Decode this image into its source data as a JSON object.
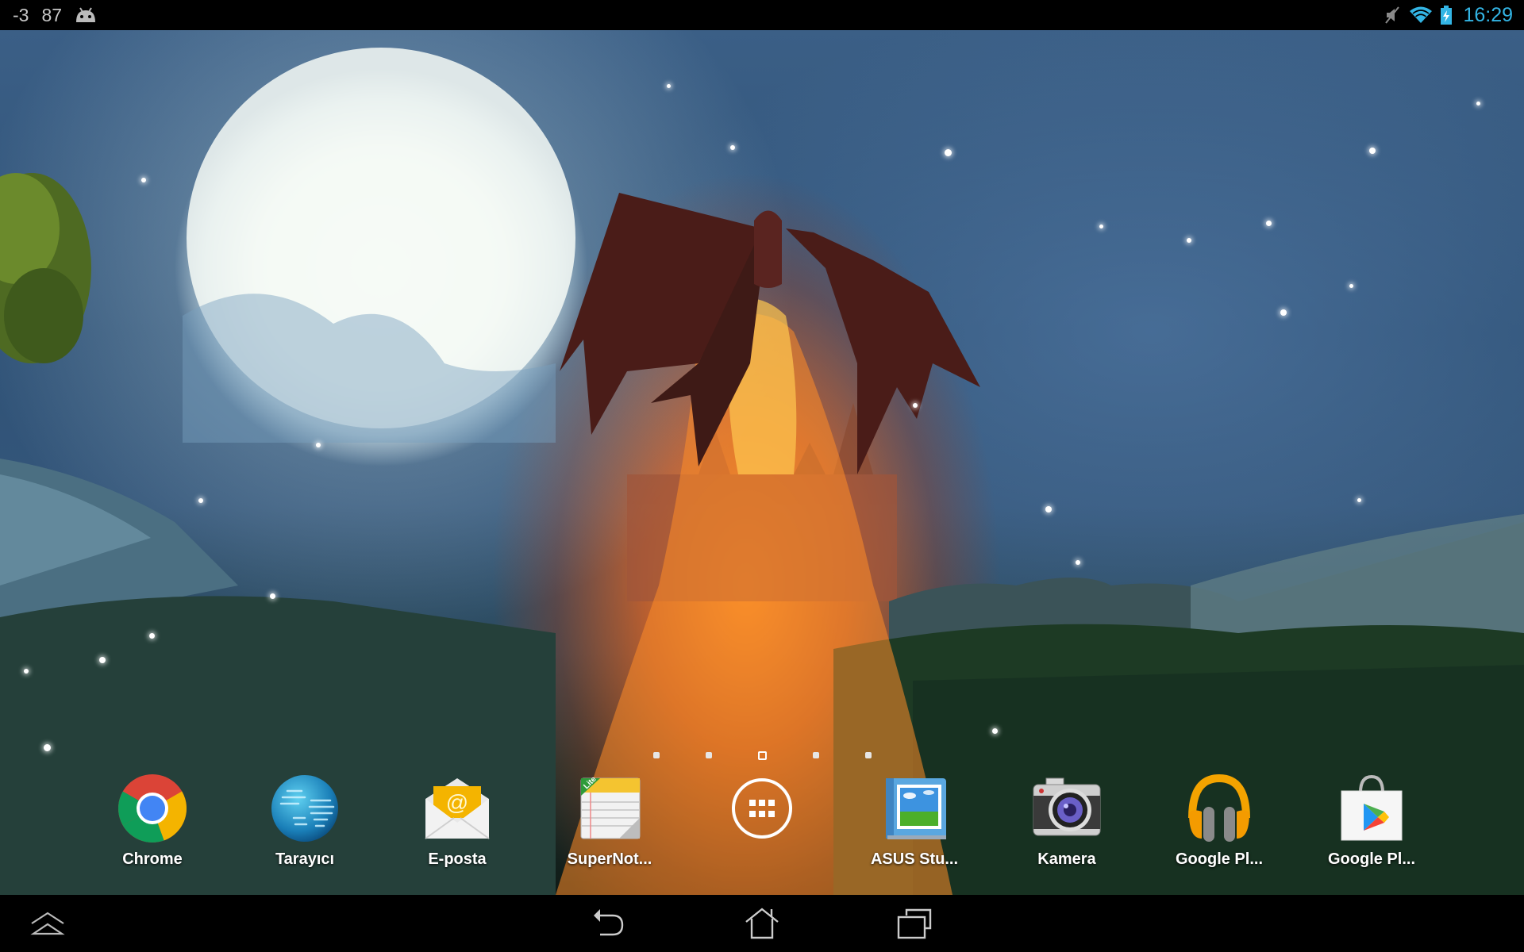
{
  "status_bar": {
    "left_indicators": [
      {
        "name": "notification-count-a",
        "text": "-3"
      },
      {
        "name": "notification-count-b",
        "text": "87"
      }
    ],
    "left_icons": [
      "android-debug-icon"
    ],
    "right_icons": [
      "mute-icon",
      "wifi-icon",
      "battery-charging-icon"
    ],
    "time": "16:29",
    "accent_color": "#33b5e5"
  },
  "home_screen": {
    "pages_total": 5,
    "current_page": 3
  },
  "dock": {
    "items": [
      {
        "name": "chrome",
        "label": "Chrome",
        "icon": "chrome-icon"
      },
      {
        "name": "browser",
        "label": "Tarayıcı",
        "icon": "globe-icon"
      },
      {
        "name": "email",
        "label": "E-posta",
        "icon": "email-envelope-icon"
      },
      {
        "name": "supernote",
        "label": "SuperNot...",
        "icon": "notepad-lite-icon",
        "badge": "Lite"
      },
      {
        "name": "app-drawer",
        "label": "",
        "icon": "app-drawer-icon"
      },
      {
        "name": "asus-studio",
        "label": "ASUS Stu...",
        "icon": "photo-album-icon"
      },
      {
        "name": "camera",
        "label": "Kamera",
        "icon": "camera-icon"
      },
      {
        "name": "google-play-music",
        "label": "Google Pl...",
        "icon": "headphones-icon"
      },
      {
        "name": "google-play-store",
        "label": "Google Pl...",
        "icon": "play-store-bag-icon"
      }
    ]
  },
  "nav_bar": {
    "buttons": [
      {
        "name": "expand-button",
        "icon": "chevron-up-icon"
      },
      {
        "name": "back-button",
        "icon": "back-arrow-icon"
      },
      {
        "name": "home-button",
        "icon": "home-icon"
      },
      {
        "name": "recent-apps-button",
        "icon": "recent-apps-icon"
      }
    ]
  }
}
